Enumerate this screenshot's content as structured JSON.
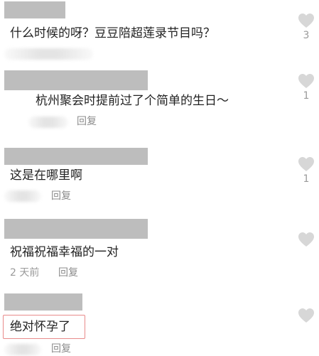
{
  "comments": [
    {
      "text": "什么时候的呀？豆豆陪超莲录节目吗？",
      "time": "",
      "reply_label": "",
      "like_count": "3"
    },
    {
      "text": "杭州聚会时提前过了个简单的生日～",
      "time": "",
      "reply_label": "回复",
      "like_count": "1"
    },
    {
      "text": "这是在哪里啊",
      "time": "",
      "reply_label": "回复",
      "like_count": "1"
    },
    {
      "text": "祝福祝福幸福的一对",
      "time": "2 天前",
      "reply_label": "回复",
      "like_count": ""
    },
    {
      "text": "绝对怀孕了",
      "time": "",
      "reply_label": "回复",
      "like_count": ""
    }
  ],
  "icons": {
    "like": "heart-icon"
  },
  "colors": {
    "heart": "#d7d7d7",
    "name_redaction": "#bdbdbd",
    "secondary_text": "#9a9a9a",
    "highlight_border": "#e88a8a"
  }
}
